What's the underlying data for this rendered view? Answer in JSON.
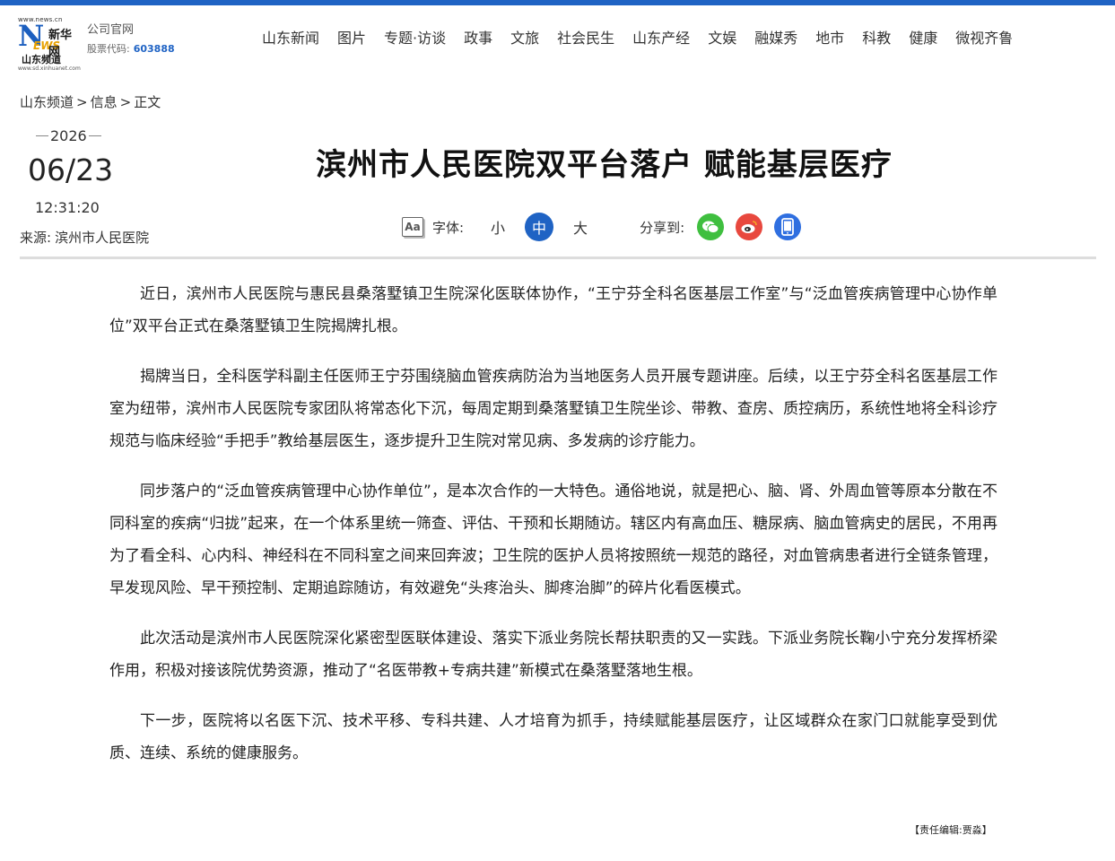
{
  "header": {
    "logo": {
      "url_text": "www.news.cn",
      "brand_n": "N",
      "brand_ews": "EWS",
      "brand_cn": "新华网",
      "channel": "山东频道",
      "sub_url": "www.sd.xinhuanet.com"
    },
    "company_label": "公司官网",
    "stock_label": "股票代码:",
    "stock_code": "603888",
    "nav": [
      "山东新闻",
      "图片",
      "专题·访谈",
      "政事",
      "文旅",
      "社会民生",
      "山东产经",
      "文娱",
      "融媒秀",
      "地市",
      "科教",
      "健康",
      "微视齐鲁"
    ]
  },
  "breadcrumb": {
    "items": [
      "山东频道",
      "信息",
      "正文"
    ],
    "separator": ">"
  },
  "meta": {
    "year": "2026",
    "month_day": "06/23",
    "time": "12:31:20",
    "source_label": "来源:",
    "source": "滨州市人民医院"
  },
  "title": "滨州市人民医院双平台落户 赋能基层医疗",
  "toolbar": {
    "font_icon_text": "Aa",
    "font_label": "字体:",
    "sizes": [
      "小",
      "中",
      "大"
    ],
    "active_size": "中",
    "share_label": "分享到:",
    "share_targets": [
      "wechat-icon",
      "weibo-icon",
      "mobile-icon"
    ]
  },
  "article": {
    "paragraphs": [
      "近日，滨州市人民医院与惠民县桑落墅镇卫生院深化医联体协作，“王宁芬全科名医基层工作室”与“泛血管疾病管理中心协作单位”双平台正式在桑落墅镇卫生院揭牌扎根。",
      "揭牌当日，全科医学科副主任医师王宁芬围绕脑血管疾病防治为当地医务人员开展专题讲座。后续，以王宁芬全科名医基层工作室为纽带，滨州市人民医院专家团队将常态化下沉，每周定期到桑落墅镇卫生院坐诊、带教、查房、质控病历，系统性地将全科诊疗规范与临床经验“手把手”教给基层医生，逐步提升卫生院对常见病、多发病的诊疗能力。",
      "同步落户的“泛血管疾病管理中心协作单位”，是本次合作的一大特色。通俗地说，就是把心、脑、肾、外周血管等原本分散在不同科室的疾病“归拢”起来，在一个体系里统一筛查、评估、干预和长期随访。辖区内有高血压、糖尿病、脑血管病史的居民，不用再为了看全科、心内科、神经科在不同科室之间来回奔波；卫生院的医护人员将按照统一规范的路径，对血管病患者进行全链条管理，早发现风险、早干预控制、定期追踪随访，有效避免“头疼治头、脚疼治脚”的碎片化看医模式。",
      "此次活动是滨州市人民医院深化紧密型医联体建设、落实下派业务院长帮扶职责的又一实践。下派业务院长鞠小宁充分发挥桥梁作用，积极对接该院优势资源，推动了“名医带教+专病共建”新模式在桑落墅落地生根。",
      "下一步，医院将以名医下沉、技术平移、专科共建、人才培育为抓手，持续赋能基层医疗，让区域群众在家门口就能享受到优质、连续、系统的健康服务。"
    ],
    "editor": "【责任编辑:贾淼】"
  },
  "colors": {
    "brand_blue": "#1f63c4",
    "wechat": "#3fbf3f",
    "weibo": "#e8483e",
    "mobile": "#2f6fe0"
  }
}
